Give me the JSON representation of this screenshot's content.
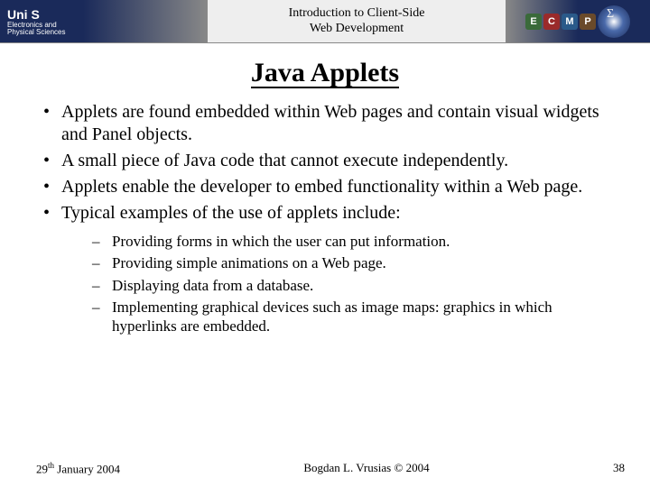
{
  "header": {
    "logo_main": "Uni S",
    "logo_sub1": "Electronics and",
    "logo_sub2": "Physical Sciences",
    "course_line1": "Introduction to Client-Side",
    "course_line2": "Web Development",
    "badges": [
      "E",
      "C",
      "M",
      "P"
    ]
  },
  "title": "Java Applets",
  "bullets": [
    "Applets are found embedded within Web pages and contain visual widgets and Panel objects.",
    "A small piece of Java code that cannot execute independently.",
    "Applets enable the developer to embed functionality within a Web page.",
    "Typical examples of the use of applets include:"
  ],
  "sub_bullets": [
    "Providing forms in which the user can put information.",
    "Providing simple animations on a Web page.",
    "Displaying data from a database.",
    "Implementing graphical devices such as image maps: graphics in which hyperlinks are embedded."
  ],
  "footer": {
    "date_day": "29",
    "date_sup": "th",
    "date_rest": " January 2004",
    "author": "Bogdan L. Vrusias © 2004",
    "page": "38"
  }
}
